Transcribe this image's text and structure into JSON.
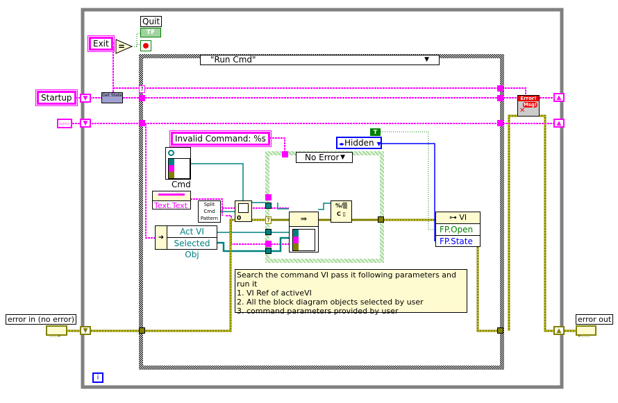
{
  "while_loop": {
    "iteration_terminal": "i"
  },
  "stop": {
    "label": "Quit",
    "indicator_text": "TF"
  },
  "constants": {
    "exit": "Exit",
    "startup": "Startup",
    "invalid_command": "Invalid Command: %s",
    "hidden": "Hidden",
    "true_const": "T"
  },
  "get_state": "Get State",
  "case_outer": {
    "selector": "\"Run Cmd\""
  },
  "case_inner": {
    "selector": "No Error"
  },
  "cmd_label": "Cmd",
  "text_property": "Text.Text",
  "split_cmd": "Split Cmd Pattern",
  "bundle": {
    "items": [
      "Act VI",
      "Selected Obj"
    ]
  },
  "vi_property": {
    "title": "VI",
    "items": [
      "FP.Open",
      "FP.State"
    ]
  },
  "error_dialog": {
    "line1": "Error!",
    "line2": "Msg!"
  },
  "comment": [
    "Search the command VI pass it following parameters and run it",
    "1. VI Ref of activeVI",
    "2. All the block diagram objects selected by user",
    "3.  command parameters provided by user"
  ],
  "error_in": {
    "label": "error in (no error)"
  },
  "error_out": {
    "label": "error out"
  },
  "colors": {
    "string_wire": "#ff00ff",
    "error_wire": "#808000",
    "ref_wire": "#008080",
    "enum_wire": "#0000ff",
    "bool_wire": "#008000",
    "loop": "#808080"
  }
}
